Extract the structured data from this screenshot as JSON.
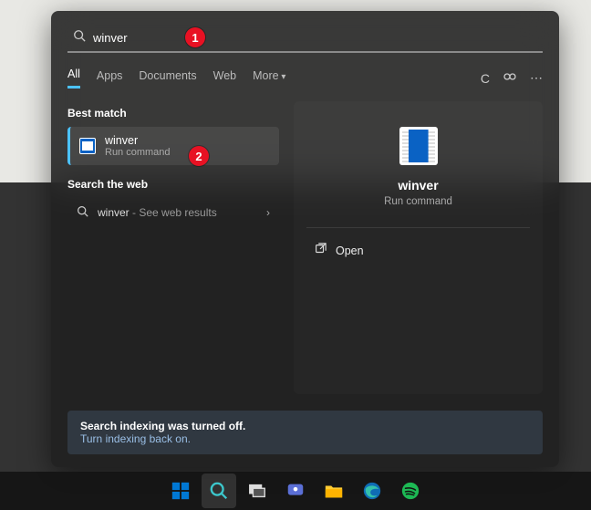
{
  "search": {
    "query": "winver"
  },
  "tabs": {
    "all": "All",
    "apps": "Apps",
    "documents": "Documents",
    "web": "Web",
    "more": "More"
  },
  "left": {
    "best_match_label": "Best match",
    "result": {
      "title": "winver",
      "subtitle": "Run command"
    },
    "search_web_label": "Search the web",
    "web": {
      "term": "winver",
      "hint": " - See web results"
    }
  },
  "detail": {
    "title": "winver",
    "subtitle": "Run command",
    "open": "Open"
  },
  "notice": {
    "title": "Search indexing was turned off.",
    "action": "Turn indexing back on."
  },
  "annotations": {
    "one": "1",
    "two": "2"
  }
}
